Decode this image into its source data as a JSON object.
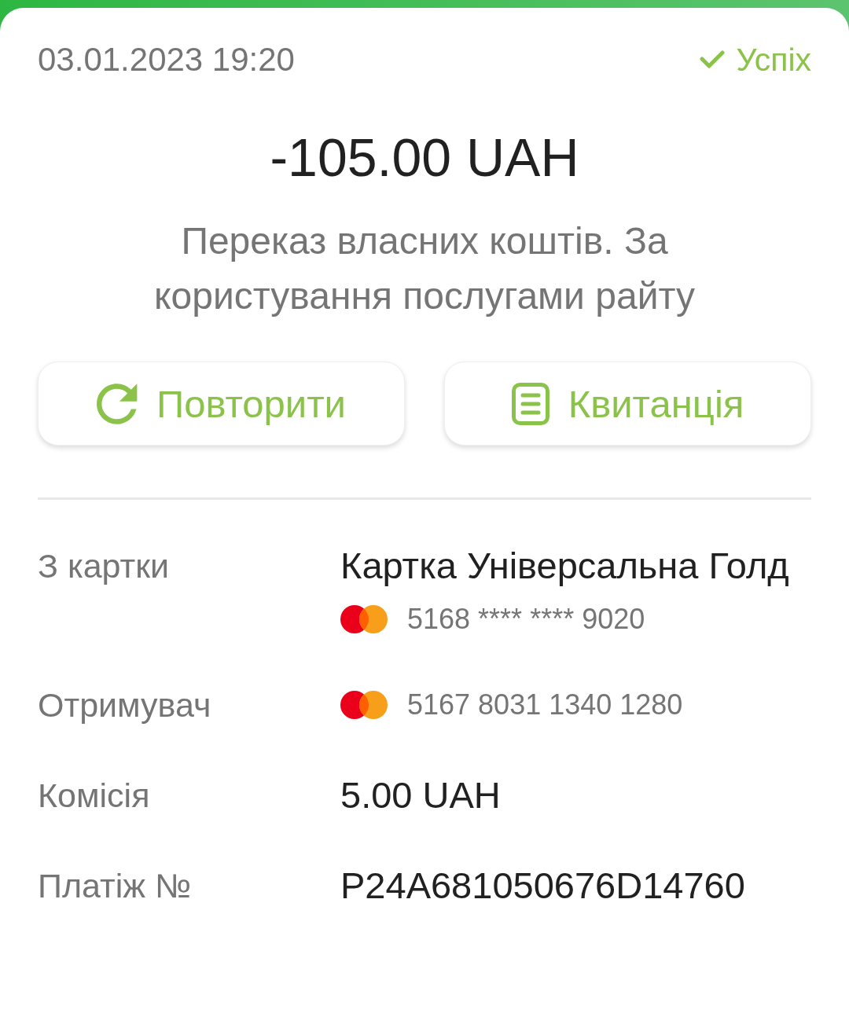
{
  "header": {
    "date": "03.01.2023 19:20",
    "status": {
      "kind": "success",
      "label": "Успіх"
    }
  },
  "amount": "-105.00 UAH",
  "description": "Переказ власних коштів. За користування послугами райту",
  "actions": [
    {
      "kind": "repeat",
      "label": "Повторити"
    },
    {
      "kind": "receipt",
      "label": "Квитанція"
    }
  ],
  "details": [
    {
      "kind": "card",
      "label": "З картки",
      "title": "Картка Універсальна Голд",
      "card_number": "5168 **** **** 9020"
    },
    {
      "kind": "card",
      "label": "Отримувач",
      "card_number": "5167 8031 1340 1280"
    },
    {
      "kind": "text",
      "label": "Комісія",
      "value": "5.00 UAH"
    },
    {
      "kind": "text",
      "label": "Платіж №",
      "value": "P24A681050676D14760"
    }
  ]
}
